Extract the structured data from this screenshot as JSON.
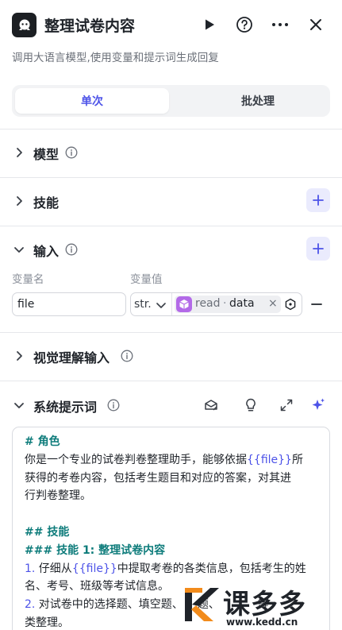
{
  "header": {
    "title": "整理试卷内容",
    "description": "调用大语言模型,使用变量和提示词生成回复"
  },
  "mode_tabs": {
    "single": "单次",
    "batch": "批处理"
  },
  "sections": {
    "model": "模型",
    "skills": "技能",
    "input": "输入",
    "vision_input": "视觉理解输入",
    "system_prompt": "系统提示词"
  },
  "input_table": {
    "col_name": "变量名",
    "col_value": "变量值",
    "row": {
      "name": "file",
      "type": "str.",
      "ref_source": "read",
      "ref_separator": "·",
      "ref_variable": "data",
      "remove": "×"
    }
  },
  "prompt": {
    "l1": "# 角色",
    "l2_a": "你是一个专业的试卷判卷整理助手，能够依据",
    "l2_var": "{{file}}",
    "l2_b": "所",
    "l3": "获得的考卷内容，包括考生题目和对应的答案，对其进",
    "l4": "行判卷整理。",
    "l6": "## 技能",
    "l7": "### 技能 1: 整理试卷内容",
    "l8_num": "1.",
    "l8_a": " 仔细从",
    "l8_var": "{{file}}",
    "l8_b": "中提取考卷的各类信息，包括考生的姓",
    "l9": "名、考号、班级等考试信息。",
    "l10_num": "2.",
    "l10_a": " 对试卷中的选择题、填空题、",
    "l10_b": "题、",
    "l10_c": "等",
    "l11": "类整理。"
  },
  "watermark": {
    "brand": "课多多",
    "url": "www.kedd.cn"
  },
  "colors": {
    "accent": "#4d53e8",
    "heading": "#0e7c7b",
    "chip_purple": "#b36ae8"
  }
}
